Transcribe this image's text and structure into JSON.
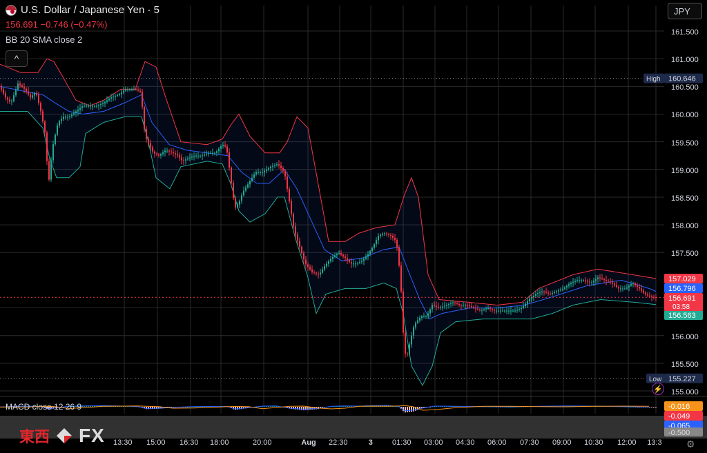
{
  "header": {
    "symbol_title": "U.S. Dollar / Japanese Yen · 5",
    "price_change": "156.691  −0.746 (−0.47%)",
    "indicator_bb": "BB 20 SMA close 2",
    "collapse_glyph": "^",
    "currency": "JPY"
  },
  "macd": {
    "legend": "MACD close 12 26 9",
    "values": [
      "-0.016",
      "-0.049",
      "-0.065",
      "-0.500"
    ],
    "colors": [
      "#f7931a",
      "#f23645",
      "#2962ff",
      "#888888"
    ]
  },
  "price_scale": {
    "ticks": [
      "161.500",
      "161.000",
      "160.500",
      "160.000",
      "159.500",
      "159.000",
      "158.500",
      "158.000",
      "157.500",
      "156.500",
      "156.000",
      "155.500",
      "155.000"
    ],
    "high_label": "High",
    "high_value": "160.646",
    "low_label": "Low",
    "low_value": "155.227",
    "last_price": "156.691",
    "countdown": "03:58",
    "bb_upper": "157.029",
    "bb_basis": "156.796",
    "bb_lower": "156.563"
  },
  "time_axis": [
    "13:30",
    "15:00",
    "16:30",
    "18:00",
    "20:00",
    "Aug",
    "22:30",
    "3",
    "01:30",
    "03:00",
    "04:30",
    "06:00",
    "07:30",
    "09:00",
    "10:30",
    "12:00",
    "13:3"
  ],
  "watermark": {
    "cn": "東西",
    "fx": "FX"
  },
  "colors": {
    "up": "#22ab94",
    "down": "#f23645",
    "bb_upper": "#f23645",
    "bb_basis": "#2962ff",
    "bb_lower": "#22ab94",
    "grid": "#2a2a2a",
    "background": "#000000"
  },
  "chart_data": {
    "type": "candlestick",
    "ylim": [
      155.0,
      161.7
    ],
    "price_series": [
      [
        0,
        160.5
      ],
      [
        8,
        160.3
      ],
      [
        16,
        160.2
      ],
      [
        26,
        160.55
      ],
      [
        36,
        160.45
      ],
      [
        44,
        160.3
      ],
      [
        52,
        160.4
      ],
      [
        60,
        160.0
      ],
      [
        66,
        159.6
      ],
      [
        70,
        158.7
      ],
      [
        76,
        159.4
      ],
      [
        84,
        159.85
      ],
      [
        92,
        159.95
      ],
      [
        100,
        159.95
      ],
      [
        110,
        160.05
      ],
      [
        120,
        160.15
      ],
      [
        130,
        160.15
      ],
      [
        140,
        160.15
      ],
      [
        150,
        160.2
      ],
      [
        160,
        160.3
      ],
      [
        172,
        160.35
      ],
      [
        182,
        160.45
      ],
      [
        196,
        160.45
      ],
      [
        204,
        160.4
      ],
      [
        210,
        159.6
      ],
      [
        216,
        159.45
      ],
      [
        222,
        159.3
      ],
      [
        230,
        159.25
      ],
      [
        240,
        159.35
      ],
      [
        250,
        159.3
      ],
      [
        258,
        159.25
      ],
      [
        264,
        159.15
      ],
      [
        272,
        159.2
      ],
      [
        282,
        159.25
      ],
      [
        292,
        159.25
      ],
      [
        302,
        159.3
      ],
      [
        312,
        159.3
      ],
      [
        322,
        159.45
      ],
      [
        328,
        159.4
      ],
      [
        334,
        158.85
      ],
      [
        340,
        158.3
      ],
      [
        346,
        158.4
      ],
      [
        352,
        158.6
      ],
      [
        360,
        158.75
      ],
      [
        370,
        158.95
      ],
      [
        380,
        158.95
      ],
      [
        392,
        159.05
      ],
      [
        402,
        159.1
      ],
      [
        412,
        158.95
      ],
      [
        418,
        158.5
      ],
      [
        426,
        157.9
      ],
      [
        434,
        157.6
      ],
      [
        442,
        157.3
      ],
      [
        452,
        157.15
      ],
      [
        462,
        157.1
      ],
      [
        470,
        157.25
      ],
      [
        480,
        157.4
      ],
      [
        490,
        157.5
      ],
      [
        500,
        157.4
      ],
      [
        508,
        157.3
      ],
      [
        516,
        157.3
      ],
      [
        524,
        157.35
      ],
      [
        532,
        157.45
      ],
      [
        540,
        157.6
      ],
      [
        548,
        157.8
      ],
      [
        556,
        157.85
      ],
      [
        566,
        157.8
      ],
      [
        574,
        157.7
      ],
      [
        580,
        157.05
      ],
      [
        584,
        156.05
      ],
      [
        588,
        155.55
      ],
      [
        594,
        155.9
      ],
      [
        600,
        156.2
      ],
      [
        610,
        156.35
      ],
      [
        618,
        156.35
      ],
      [
        626,
        156.55
      ],
      [
        636,
        156.5
      ],
      [
        646,
        156.55
      ],
      [
        656,
        156.6
      ],
      [
        666,
        156.55
      ],
      [
        676,
        156.55
      ],
      [
        686,
        156.5
      ],
      [
        696,
        156.45
      ],
      [
        706,
        156.5
      ],
      [
        716,
        156.45
      ],
      [
        726,
        156.45
      ],
      [
        736,
        156.45
      ],
      [
        746,
        156.45
      ],
      [
        756,
        156.5
      ],
      [
        766,
        156.65
      ],
      [
        776,
        156.75
      ],
      [
        786,
        156.8
      ],
      [
        796,
        156.75
      ],
      [
        806,
        156.8
      ],
      [
        816,
        156.85
      ],
      [
        826,
        156.95
      ],
      [
        836,
        157.0
      ],
      [
        846,
        157.0
      ],
      [
        856,
        156.95
      ],
      [
        866,
        157.05
      ],
      [
        876,
        157.0
      ],
      [
        886,
        156.95
      ],
      [
        896,
        156.85
      ],
      [
        906,
        156.85
      ],
      [
        916,
        156.95
      ],
      [
        926,
        156.85
      ],
      [
        934,
        156.75
      ],
      [
        942,
        156.7
      ],
      [
        950,
        156.69
      ]
    ],
    "series": [
      {
        "name": "BB upper",
        "values": [
          [
            0,
            160.9
          ],
          [
            30,
            160.75
          ],
          [
            55,
            160.75
          ],
          [
            68,
            161.0
          ],
          [
            78,
            160.95
          ],
          [
            92,
            160.65
          ],
          [
            110,
            160.25
          ],
          [
            130,
            160.15
          ],
          [
            150,
            160.25
          ],
          [
            175,
            160.45
          ],
          [
            196,
            160.45
          ],
          [
            210,
            160.95
          ],
          [
            226,
            160.85
          ],
          [
            240,
            160.3
          ],
          [
            262,
            159.5
          ],
          [
            300,
            159.45
          ],
          [
            322,
            159.55
          ],
          [
            334,
            159.8
          ],
          [
            346,
            160.0
          ],
          [
            362,
            159.6
          ],
          [
            384,
            159.3
          ],
          [
            405,
            159.3
          ],
          [
            416,
            159.5
          ],
          [
            430,
            159.95
          ],
          [
            446,
            159.75
          ],
          [
            460,
            158.8
          ],
          [
            476,
            157.7
          ],
          [
            500,
            157.7
          ],
          [
            520,
            157.85
          ],
          [
            545,
            157.95
          ],
          [
            572,
            158.0
          ],
          [
            586,
            158.55
          ],
          [
            596,
            158.85
          ],
          [
            606,
            158.5
          ],
          [
            620,
            157.1
          ],
          [
            636,
            156.65
          ],
          [
            680,
            156.6
          ],
          [
            720,
            156.55
          ],
          [
            756,
            156.6
          ],
          [
            780,
            156.85
          ],
          [
            830,
            157.1
          ],
          [
            866,
            157.2
          ],
          [
            916,
            157.1
          ],
          [
            950,
            157.03
          ]
        ]
      },
      {
        "name": "BB basis",
        "values": [
          [
            0,
            160.5
          ],
          [
            40,
            160.4
          ],
          [
            62,
            160.35
          ],
          [
            80,
            160.2
          ],
          [
            100,
            160.05
          ],
          [
            120,
            160.0
          ],
          [
            150,
            160.05
          ],
          [
            180,
            160.2
          ],
          [
            205,
            160.35
          ],
          [
            220,
            159.85
          ],
          [
            245,
            159.45
          ],
          [
            270,
            159.35
          ],
          [
            300,
            159.3
          ],
          [
            330,
            159.25
          ],
          [
            350,
            158.95
          ],
          [
            372,
            158.75
          ],
          [
            390,
            158.75
          ],
          [
            412,
            159.0
          ],
          [
            430,
            158.65
          ],
          [
            450,
            158.1
          ],
          [
            470,
            157.55
          ],
          [
            495,
            157.35
          ],
          [
            525,
            157.4
          ],
          [
            555,
            157.55
          ],
          [
            578,
            157.6
          ],
          [
            592,
            157.15
          ],
          [
            608,
            156.65
          ],
          [
            622,
            156.3
          ],
          [
            640,
            156.4
          ],
          [
            680,
            156.5
          ],
          [
            720,
            156.5
          ],
          [
            760,
            156.55
          ],
          [
            800,
            156.7
          ],
          [
            850,
            156.9
          ],
          [
            900,
            157.0
          ],
          [
            940,
            156.85
          ],
          [
            950,
            156.8
          ]
        ]
      },
      {
        "name": "BB lower",
        "values": [
          [
            0,
            160.05
          ],
          [
            40,
            160.05
          ],
          [
            62,
            159.75
          ],
          [
            72,
            159.2
          ],
          [
            82,
            158.85
          ],
          [
            100,
            158.85
          ],
          [
            116,
            159.05
          ],
          [
            124,
            159.65
          ],
          [
            150,
            159.85
          ],
          [
            180,
            159.95
          ],
          [
            205,
            159.95
          ],
          [
            214,
            159.55
          ],
          [
            226,
            158.85
          ],
          [
            246,
            158.65
          ],
          [
            262,
            159.05
          ],
          [
            300,
            159.15
          ],
          [
            322,
            159.1
          ],
          [
            334,
            158.75
          ],
          [
            346,
            158.25
          ],
          [
            362,
            158.05
          ],
          [
            384,
            158.2
          ],
          [
            402,
            158.5
          ],
          [
            412,
            158.5
          ],
          [
            428,
            157.75
          ],
          [
            446,
            157.05
          ],
          [
            458,
            156.4
          ],
          [
            472,
            156.75
          ],
          [
            500,
            156.85
          ],
          [
            530,
            156.85
          ],
          [
            556,
            156.95
          ],
          [
            574,
            156.85
          ],
          [
            584,
            156.4
          ],
          [
            596,
            155.45
          ],
          [
            612,
            155.1
          ],
          [
            626,
            155.45
          ],
          [
            638,
            156.05
          ],
          [
            660,
            156.25
          ],
          [
            700,
            156.3
          ],
          [
            740,
            156.3
          ],
          [
            770,
            156.3
          ],
          [
            800,
            156.4
          ],
          [
            830,
            156.55
          ],
          [
            870,
            156.65
          ],
          [
            920,
            156.6
          ],
          [
            950,
            156.56
          ]
        ]
      }
    ],
    "macd_histogram": [
      [
        0,
        -0.02
      ],
      [
        20,
        0.03
      ],
      [
        40,
        0.05
      ],
      [
        60,
        0.02
      ],
      [
        70,
        -0.15
      ],
      [
        80,
        -0.08
      ],
      [
        100,
        0.04
      ],
      [
        120,
        0.06
      ],
      [
        150,
        0.08
      ],
      [
        180,
        0.05
      ],
      [
        200,
        0.02
      ],
      [
        212,
        -0.12
      ],
      [
        230,
        -0.1
      ],
      [
        250,
        -0.04
      ],
      [
        280,
        0.01
      ],
      [
        310,
        0.03
      ],
      [
        330,
        0.02
      ],
      [
        340,
        -0.16
      ],
      [
        360,
        -0.06
      ],
      [
        380,
        0.05
      ],
      [
        400,
        0.06
      ],
      [
        420,
        -0.1
      ],
      [
        440,
        -0.18
      ],
      [
        460,
        -0.12
      ],
      [
        480,
        0.04
      ],
      [
        500,
        0.06
      ],
      [
        520,
        0.05
      ],
      [
        540,
        0.08
      ],
      [
        560,
        0.1
      ],
      [
        578,
        0.02
      ],
      [
        586,
        -0.3
      ],
      [
        598,
        -0.25
      ],
      [
        612,
        -0.08
      ],
      [
        630,
        0.05
      ],
      [
        660,
        0.04
      ],
      [
        700,
        0.02
      ],
      [
        740,
        0.0
      ],
      [
        780,
        0.04
      ],
      [
        820,
        0.06
      ],
      [
        860,
        0.05
      ],
      [
        900,
        0.02
      ],
      [
        940,
        -0.02
      ]
    ]
  }
}
